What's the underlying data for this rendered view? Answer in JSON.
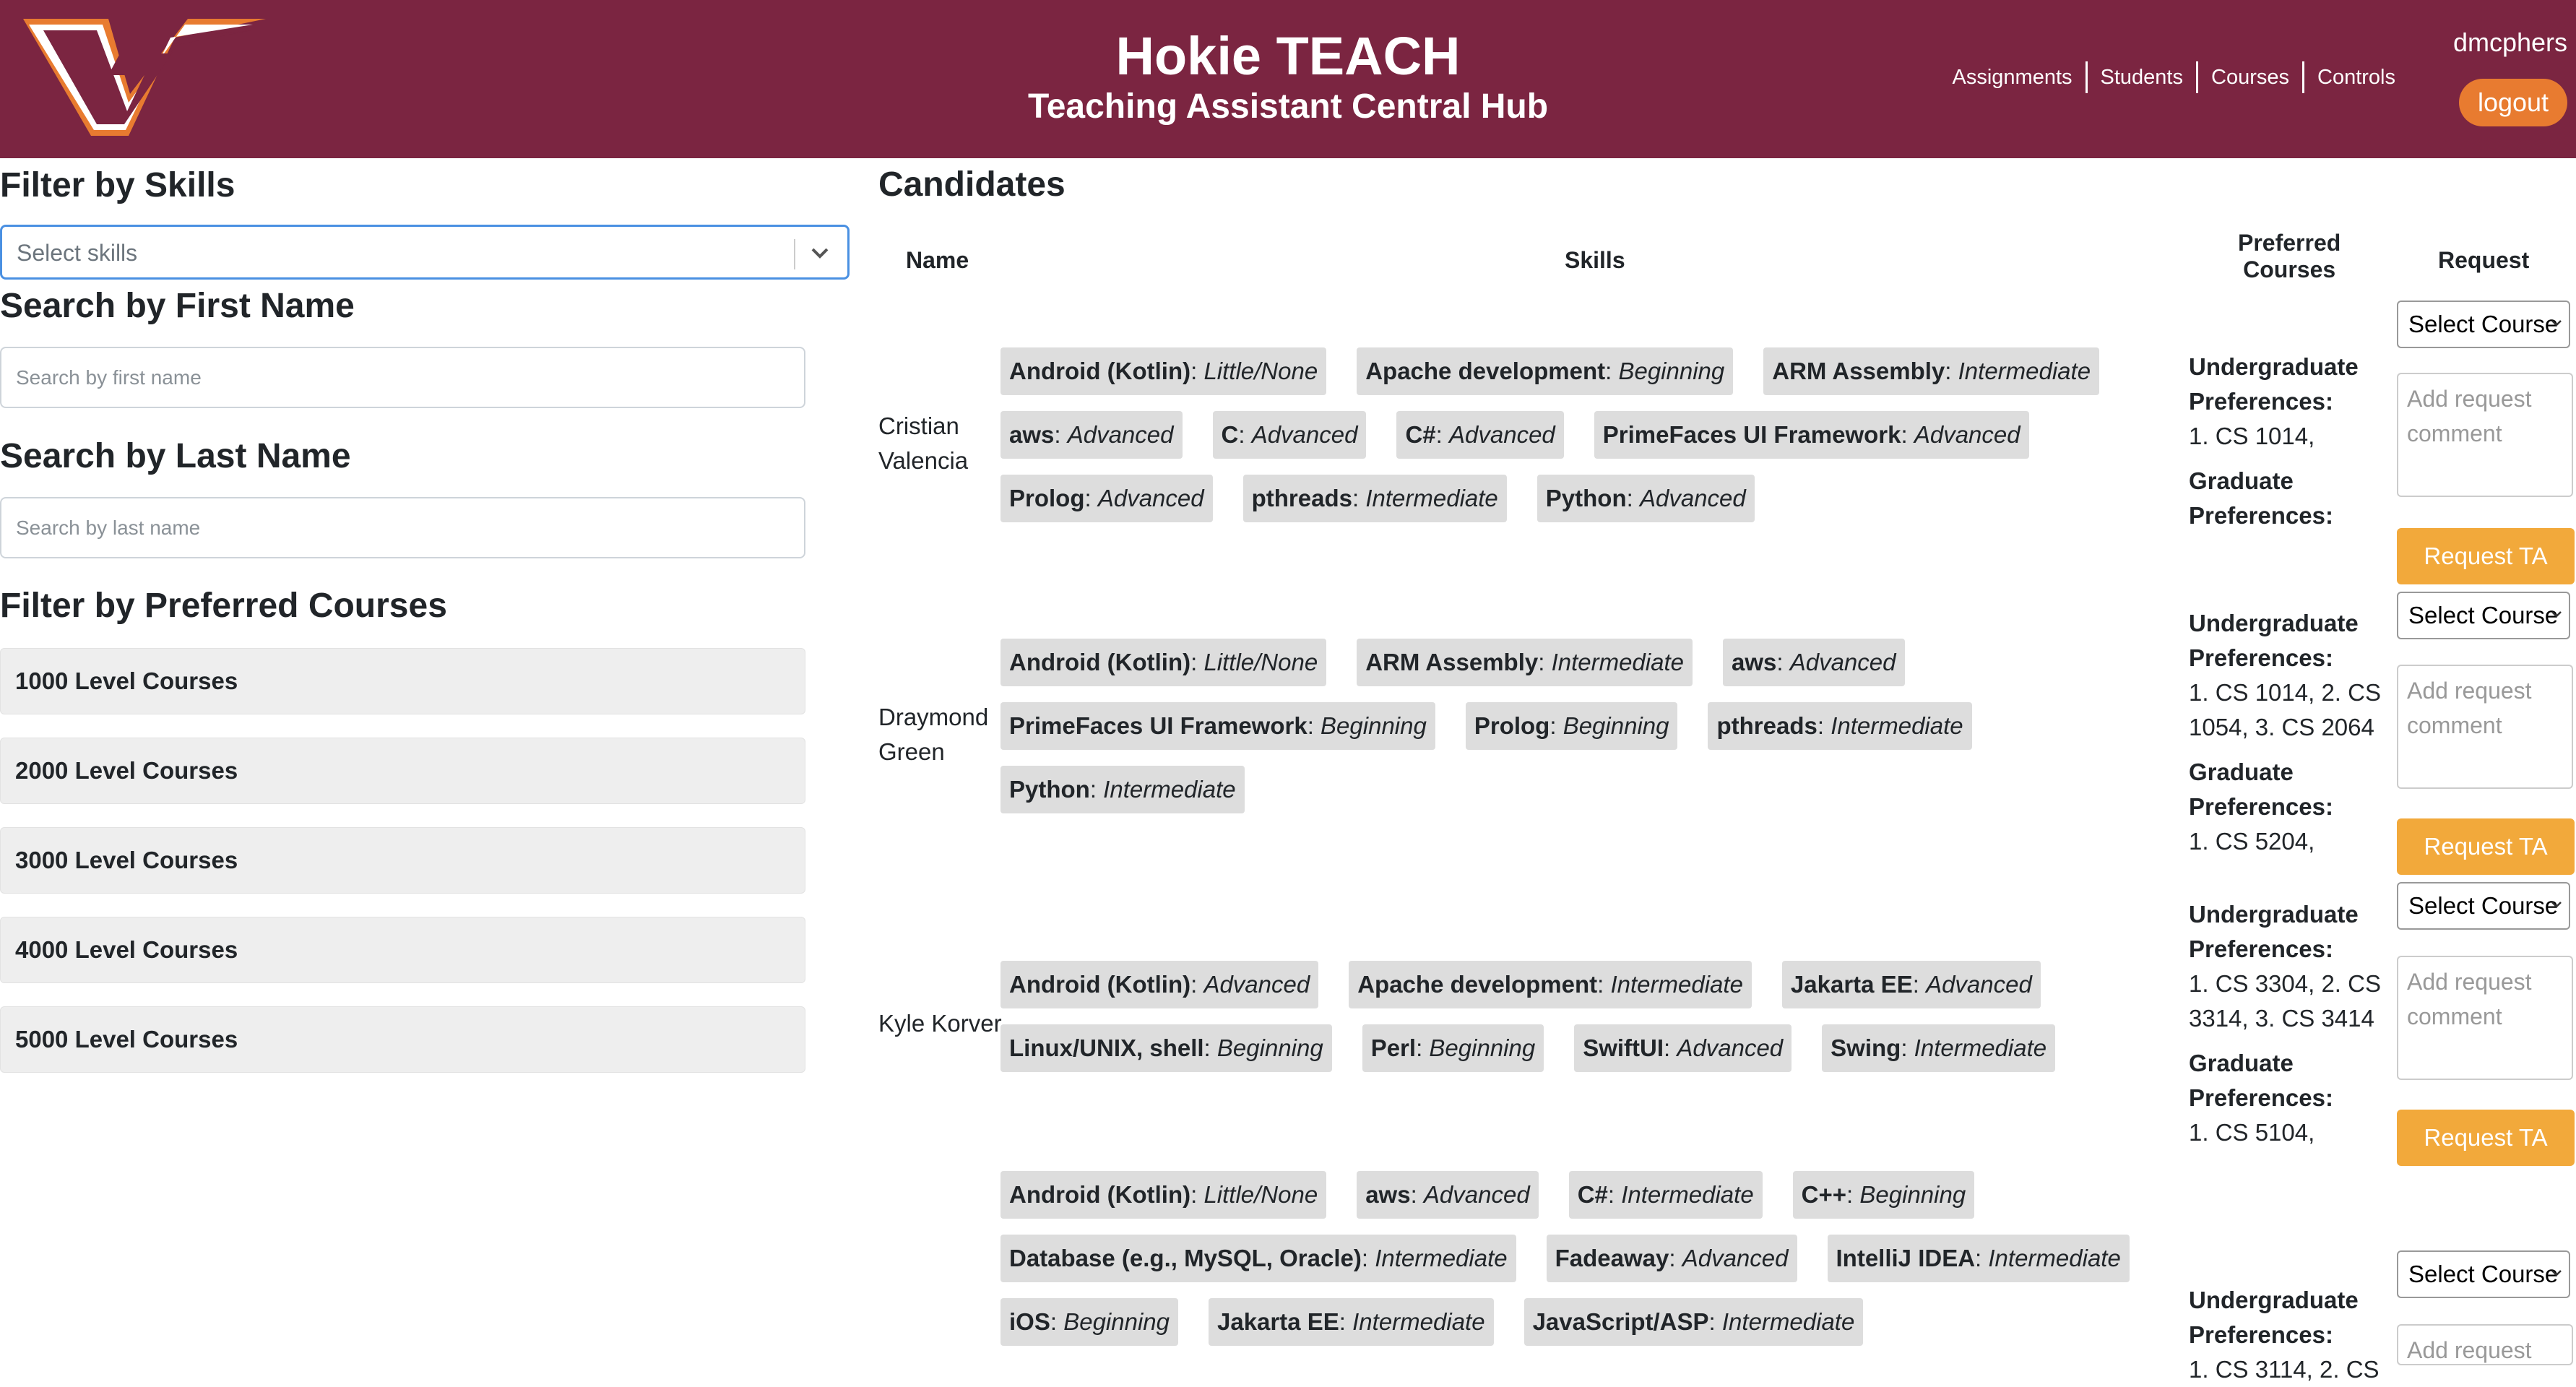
{
  "header": {
    "title": "Hokie TEACH",
    "subtitle": "Teaching Assistant Central Hub",
    "nav": [
      "Assignments",
      "Students",
      "Courses",
      "Controls"
    ],
    "username": "dmcphers",
    "logout": "logout",
    "brand_color": "#7b2541",
    "accent_color": "#e87b30"
  },
  "filters": {
    "skills_heading": "Filter by Skills",
    "skills_placeholder": "Select skills",
    "first_heading": "Search by First Name",
    "first_placeholder": "Search by first name",
    "last_heading": "Search by Last Name",
    "last_placeholder": "Search by last name",
    "courses_heading": "Filter by Preferred Courses",
    "course_levels": [
      "1000 Level Courses",
      "2000 Level Courses",
      "3000 Level Courses",
      "4000 Level Courses",
      "5000 Level Courses"
    ]
  },
  "candidates": {
    "title": "Candidates",
    "columns": {
      "name": "Name",
      "skills": "Skills",
      "preferred_1": "Preferred",
      "preferred_2": "Courses",
      "request": "Request"
    },
    "select_label": "Select Course",
    "comment_placeholder_1": "Add request",
    "comment_placeholder_2": "comment",
    "request_label": "Request TA",
    "undergrad_label_1": "Undergraduate",
    "undergrad_label_2": "Preferences:",
    "grad_label_1": "Graduate",
    "grad_label_2": "Preferences:",
    "rows": [
      {
        "first": "Cristian",
        "last": "Valencia",
        "skills": [
          [
            [
              "Android (Kotlin)",
              "Little/None"
            ],
            [
              "Apache development",
              "Beginning"
            ],
            [
              "ARM Assembly",
              "Intermediate"
            ]
          ],
          [
            [
              "aws",
              "Advanced"
            ],
            [
              "C",
              "Advanced"
            ],
            [
              "C#",
              "Advanced"
            ],
            [
              "PrimeFaces UI Framework",
              "Advanced"
            ]
          ],
          [
            [
              "Prolog",
              "Advanced"
            ],
            [
              "pthreads",
              "Intermediate"
            ],
            [
              "Python",
              "Advanced"
            ]
          ]
        ],
        "ug_prefs": [
          "1. CS 1014,"
        ],
        "grad_prefs": []
      },
      {
        "first": "Draymond",
        "last": "Green",
        "skills": [
          [
            [
              "Android (Kotlin)",
              "Little/None"
            ],
            [
              "ARM Assembly",
              "Intermediate"
            ],
            [
              "aws",
              "Advanced"
            ]
          ],
          [
            [
              "PrimeFaces UI Framework",
              "Beginning"
            ],
            [
              "Prolog",
              "Beginning"
            ],
            [
              "pthreads",
              "Intermediate"
            ]
          ],
          [
            [
              "Python",
              "Intermediate"
            ]
          ]
        ],
        "ug_prefs": [
          "1. CS 1014, 2. CS",
          "1054, 3. CS 2064"
        ],
        "grad_prefs": [
          "1. CS 5204,"
        ]
      },
      {
        "first": "Kyle Korver",
        "last": "",
        "skills": [
          [
            [
              "Android (Kotlin)",
              "Advanced"
            ],
            [
              "Apache development",
              "Intermediate"
            ],
            [
              "Jakarta EE",
              "Advanced"
            ]
          ],
          [
            [
              "Linux/UNIX, shell",
              "Beginning"
            ],
            [
              "Perl",
              "Beginning"
            ],
            [
              "SwiftUI",
              "Advanced"
            ],
            [
              "Swing",
              "Intermediate"
            ]
          ]
        ],
        "ug_prefs": [
          "1. CS 3304, 2. CS",
          "3314, 3. CS 3414"
        ],
        "grad_prefs": [
          "1. CS 5104,"
        ]
      },
      {
        "first": "",
        "last": "",
        "skills": [
          [
            [
              "Android (Kotlin)",
              "Little/None"
            ],
            [
              "aws",
              "Advanced"
            ],
            [
              "C#",
              "Intermediate"
            ],
            [
              "C++",
              "Beginning"
            ]
          ],
          [
            [
              "Database (e.g., MySQL, Oracle)",
              "Intermediate"
            ],
            [
              "Fadeaway",
              "Advanced"
            ],
            [
              "IntelliJ IDEA",
              "Intermediate"
            ]
          ],
          [
            [
              "iOS",
              "Beginning"
            ],
            [
              "Jakarta EE",
              "Intermediate"
            ],
            [
              "JavaScript/ASP",
              "Intermediate"
            ]
          ]
        ],
        "ug_prefs": [
          "1. CS 3114, 2. CS"
        ],
        "grad_prefs": []
      }
    ]
  }
}
